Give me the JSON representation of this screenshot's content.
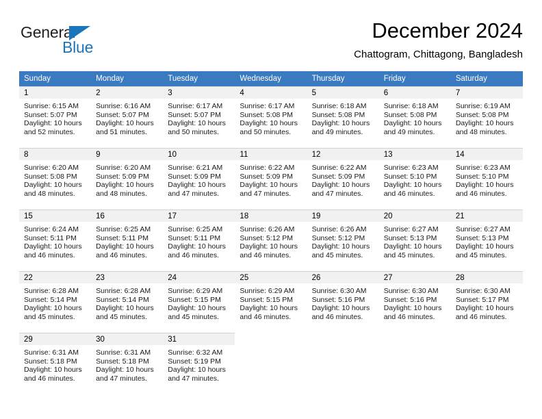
{
  "brand": {
    "name_part1": "General",
    "name_part2": "Blue",
    "triangle_color": "#1b75bb",
    "text_color": "#231f20"
  },
  "header": {
    "title": "December 2024",
    "subtitle": "Chattogram, Chittagong, Bangladesh"
  },
  "theme": {
    "header_bg": "#3a7ac0",
    "header_text": "#ffffff",
    "daynum_bg": "#f1f1f1",
    "cell_border": "#d2d2d2",
    "page_bg": "#ffffff"
  },
  "calendar": {
    "weekday_headers": [
      "Sunday",
      "Monday",
      "Tuesday",
      "Wednesday",
      "Thursday",
      "Friday",
      "Saturday"
    ],
    "weeks": [
      [
        {
          "day": "1",
          "sunrise": "Sunrise: 6:15 AM",
          "sunset": "Sunset: 5:07 PM",
          "daylight_line1": "Daylight: 10 hours",
          "daylight_line2": "and 52 minutes."
        },
        {
          "day": "2",
          "sunrise": "Sunrise: 6:16 AM",
          "sunset": "Sunset: 5:07 PM",
          "daylight_line1": "Daylight: 10 hours",
          "daylight_line2": "and 51 minutes."
        },
        {
          "day": "3",
          "sunrise": "Sunrise: 6:17 AM",
          "sunset": "Sunset: 5:07 PM",
          "daylight_line1": "Daylight: 10 hours",
          "daylight_line2": "and 50 minutes."
        },
        {
          "day": "4",
          "sunrise": "Sunrise: 6:17 AM",
          "sunset": "Sunset: 5:08 PM",
          "daylight_line1": "Daylight: 10 hours",
          "daylight_line2": "and 50 minutes."
        },
        {
          "day": "5",
          "sunrise": "Sunrise: 6:18 AM",
          "sunset": "Sunset: 5:08 PM",
          "daylight_line1": "Daylight: 10 hours",
          "daylight_line2": "and 49 minutes."
        },
        {
          "day": "6",
          "sunrise": "Sunrise: 6:18 AM",
          "sunset": "Sunset: 5:08 PM",
          "daylight_line1": "Daylight: 10 hours",
          "daylight_line2": "and 49 minutes."
        },
        {
          "day": "7",
          "sunrise": "Sunrise: 6:19 AM",
          "sunset": "Sunset: 5:08 PM",
          "daylight_line1": "Daylight: 10 hours",
          "daylight_line2": "and 48 minutes."
        }
      ],
      [
        {
          "day": "8",
          "sunrise": "Sunrise: 6:20 AM",
          "sunset": "Sunset: 5:08 PM",
          "daylight_line1": "Daylight: 10 hours",
          "daylight_line2": "and 48 minutes."
        },
        {
          "day": "9",
          "sunrise": "Sunrise: 6:20 AM",
          "sunset": "Sunset: 5:09 PM",
          "daylight_line1": "Daylight: 10 hours",
          "daylight_line2": "and 48 minutes."
        },
        {
          "day": "10",
          "sunrise": "Sunrise: 6:21 AM",
          "sunset": "Sunset: 5:09 PM",
          "daylight_line1": "Daylight: 10 hours",
          "daylight_line2": "and 47 minutes."
        },
        {
          "day": "11",
          "sunrise": "Sunrise: 6:22 AM",
          "sunset": "Sunset: 5:09 PM",
          "daylight_line1": "Daylight: 10 hours",
          "daylight_line2": "and 47 minutes."
        },
        {
          "day": "12",
          "sunrise": "Sunrise: 6:22 AM",
          "sunset": "Sunset: 5:09 PM",
          "daylight_line1": "Daylight: 10 hours",
          "daylight_line2": "and 47 minutes."
        },
        {
          "day": "13",
          "sunrise": "Sunrise: 6:23 AM",
          "sunset": "Sunset: 5:10 PM",
          "daylight_line1": "Daylight: 10 hours",
          "daylight_line2": "and 46 minutes."
        },
        {
          "day": "14",
          "sunrise": "Sunrise: 6:23 AM",
          "sunset": "Sunset: 5:10 PM",
          "daylight_line1": "Daylight: 10 hours",
          "daylight_line2": "and 46 minutes."
        }
      ],
      [
        {
          "day": "15",
          "sunrise": "Sunrise: 6:24 AM",
          "sunset": "Sunset: 5:11 PM",
          "daylight_line1": "Daylight: 10 hours",
          "daylight_line2": "and 46 minutes."
        },
        {
          "day": "16",
          "sunrise": "Sunrise: 6:25 AM",
          "sunset": "Sunset: 5:11 PM",
          "daylight_line1": "Daylight: 10 hours",
          "daylight_line2": "and 46 minutes."
        },
        {
          "day": "17",
          "sunrise": "Sunrise: 6:25 AM",
          "sunset": "Sunset: 5:11 PM",
          "daylight_line1": "Daylight: 10 hours",
          "daylight_line2": "and 46 minutes."
        },
        {
          "day": "18",
          "sunrise": "Sunrise: 6:26 AM",
          "sunset": "Sunset: 5:12 PM",
          "daylight_line1": "Daylight: 10 hours",
          "daylight_line2": "and 46 minutes."
        },
        {
          "day": "19",
          "sunrise": "Sunrise: 6:26 AM",
          "sunset": "Sunset: 5:12 PM",
          "daylight_line1": "Daylight: 10 hours",
          "daylight_line2": "and 45 minutes."
        },
        {
          "day": "20",
          "sunrise": "Sunrise: 6:27 AM",
          "sunset": "Sunset: 5:13 PM",
          "daylight_line1": "Daylight: 10 hours",
          "daylight_line2": "and 45 minutes."
        },
        {
          "day": "21",
          "sunrise": "Sunrise: 6:27 AM",
          "sunset": "Sunset: 5:13 PM",
          "daylight_line1": "Daylight: 10 hours",
          "daylight_line2": "and 45 minutes."
        }
      ],
      [
        {
          "day": "22",
          "sunrise": "Sunrise: 6:28 AM",
          "sunset": "Sunset: 5:14 PM",
          "daylight_line1": "Daylight: 10 hours",
          "daylight_line2": "and 45 minutes."
        },
        {
          "day": "23",
          "sunrise": "Sunrise: 6:28 AM",
          "sunset": "Sunset: 5:14 PM",
          "daylight_line1": "Daylight: 10 hours",
          "daylight_line2": "and 45 minutes."
        },
        {
          "day": "24",
          "sunrise": "Sunrise: 6:29 AM",
          "sunset": "Sunset: 5:15 PM",
          "daylight_line1": "Daylight: 10 hours",
          "daylight_line2": "and 45 minutes."
        },
        {
          "day": "25",
          "sunrise": "Sunrise: 6:29 AM",
          "sunset": "Sunset: 5:15 PM",
          "daylight_line1": "Daylight: 10 hours",
          "daylight_line2": "and 46 minutes."
        },
        {
          "day": "26",
          "sunrise": "Sunrise: 6:30 AM",
          "sunset": "Sunset: 5:16 PM",
          "daylight_line1": "Daylight: 10 hours",
          "daylight_line2": "and 46 minutes."
        },
        {
          "day": "27",
          "sunrise": "Sunrise: 6:30 AM",
          "sunset": "Sunset: 5:16 PM",
          "daylight_line1": "Daylight: 10 hours",
          "daylight_line2": "and 46 minutes."
        },
        {
          "day": "28",
          "sunrise": "Sunrise: 6:30 AM",
          "sunset": "Sunset: 5:17 PM",
          "daylight_line1": "Daylight: 10 hours",
          "daylight_line2": "and 46 minutes."
        }
      ],
      [
        {
          "day": "29",
          "sunrise": "Sunrise: 6:31 AM",
          "sunset": "Sunset: 5:18 PM",
          "daylight_line1": "Daylight: 10 hours",
          "daylight_line2": "and 46 minutes."
        },
        {
          "day": "30",
          "sunrise": "Sunrise: 6:31 AM",
          "sunset": "Sunset: 5:18 PM",
          "daylight_line1": "Daylight: 10 hours",
          "daylight_line2": "and 47 minutes."
        },
        {
          "day": "31",
          "sunrise": "Sunrise: 6:32 AM",
          "sunset": "Sunset: 5:19 PM",
          "daylight_line1": "Daylight: 10 hours",
          "daylight_line2": "and 47 minutes."
        },
        null,
        null,
        null,
        null
      ]
    ]
  }
}
